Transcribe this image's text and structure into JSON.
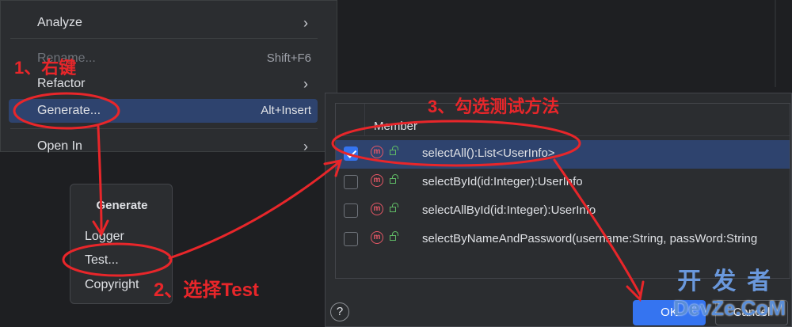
{
  "context_menu": {
    "items": [
      {
        "label": "Analyze",
        "shortcut": "",
        "submenu": true
      },
      {
        "label": "Rename...",
        "shortcut": "Shift+F6",
        "submenu": false
      },
      {
        "label": "Refactor",
        "shortcut": "",
        "submenu": true
      },
      {
        "label": "Generate...",
        "shortcut": "Alt+Insert",
        "submenu": false
      },
      {
        "label": "Open In",
        "shortcut": "",
        "submenu": true
      }
    ],
    "submenu_arrow": "›"
  },
  "generate_popup": {
    "title": "Generate",
    "items": [
      "Logger",
      "Test...",
      "Copyright"
    ]
  },
  "member_dialog": {
    "column_header": "Member",
    "rows": [
      {
        "checked": true,
        "signature": "selectAll():List<UserInfo>"
      },
      {
        "checked": false,
        "signature": "selectById(id:Integer):UserInfo"
      },
      {
        "checked": false,
        "signature": "selectAllById(id:Integer):UserInfo"
      },
      {
        "checked": false,
        "signature": "selectByNameAndPassword(username:String, passWord:String"
      }
    ],
    "help": "?",
    "ok_label": "OK",
    "cancel_label": "Cancel",
    "icons": {
      "method": "method-icon",
      "visibility": "public-lock-icon",
      "method_glyph": "m"
    }
  },
  "annotations": {
    "step1": "1、右键",
    "step2": "2、选择Test",
    "step3": "3、勾选测试方法",
    "color": "#e8262a"
  },
  "watermark": {
    "cn": "开发者",
    "en": "DevZe.CoM"
  },
  "colors": {
    "accent": "#3574f0",
    "selection": "#2e436e",
    "background": "#1e1f22"
  }
}
